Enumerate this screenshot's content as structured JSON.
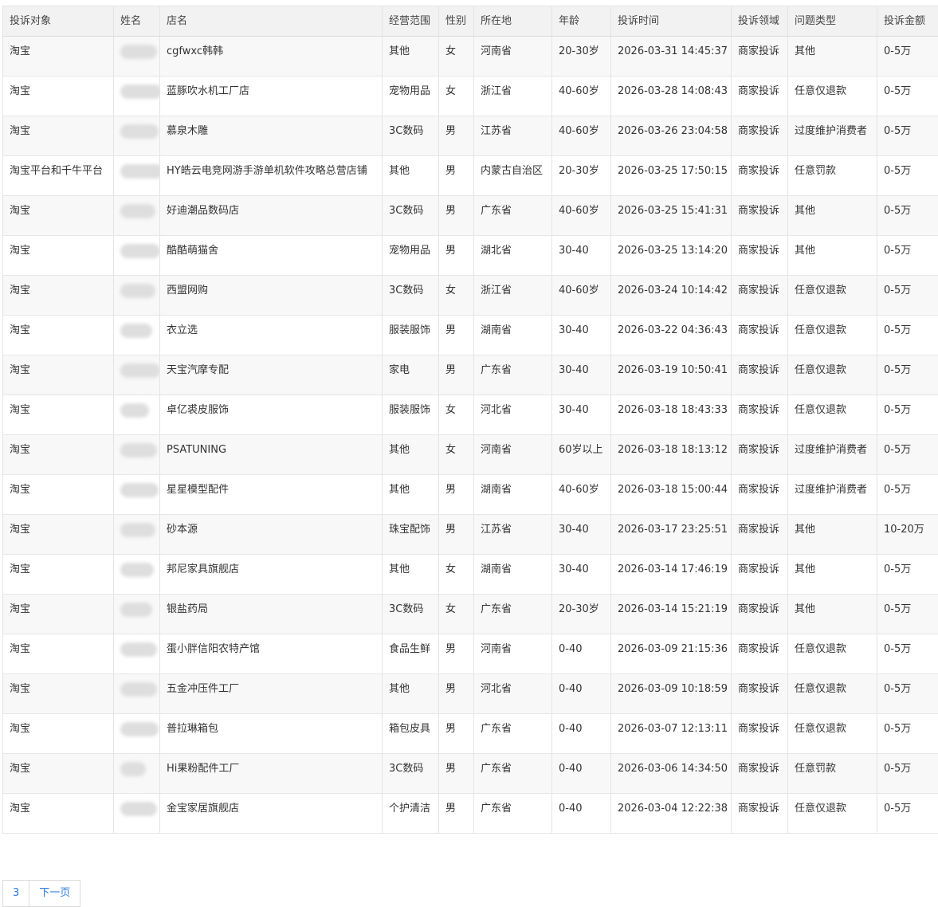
{
  "columns": [
    "投诉对象",
    "姓名",
    "店名",
    "经营范围",
    "性别",
    "所在地",
    "年龄",
    "投诉时间",
    "投诉领域",
    "问题类型",
    "投诉金额"
  ],
  "rows": [
    {
      "target": "淘宝",
      "name": "",
      "shop": "cgfwxc韩韩",
      "scope": "其他",
      "gender": "女",
      "location": "河南省",
      "age": "20-30岁",
      "time": "2026-03-31 14:45:37",
      "field": "商家投诉",
      "issue": "其他",
      "amount": "0-5万"
    },
    {
      "target": "淘宝",
      "name": "",
      "shop": "蓝豚吹水机工厂店",
      "scope": "宠物用品",
      "gender": "女",
      "location": "浙江省",
      "age": "40-60岁",
      "time": "2026-03-28 14:08:43",
      "field": "商家投诉",
      "issue": "任意仅退款",
      "amount": "0-5万"
    },
    {
      "target": "淘宝",
      "name": "",
      "shop": "慕泉木雕",
      "scope": "3C数码",
      "gender": "男",
      "location": "江苏省",
      "age": "40-60岁",
      "time": "2026-03-26 23:04:58",
      "field": "商家投诉",
      "issue": "过度维护消费者",
      "amount": "0-5万"
    },
    {
      "target": "淘宝平台和千牛平台",
      "name": "",
      "shop": "HY皓云电竞网游手游单机软件攻略总营店铺",
      "scope": "其他",
      "gender": "男",
      "location": "内蒙古自治区",
      "age": "20-30岁",
      "time": "2026-03-25 17:50:15",
      "field": "商家投诉",
      "issue": "任意罚款",
      "amount": "0-5万"
    },
    {
      "target": "淘宝",
      "name": "",
      "shop": "好迪潮品数码店",
      "scope": "3C数码",
      "gender": "男",
      "location": "广东省",
      "age": "40-60岁",
      "time": "2026-03-25 15:41:31",
      "field": "商家投诉",
      "issue": "其他",
      "amount": "0-5万"
    },
    {
      "target": "淘宝",
      "name": "",
      "shop": "酷酷萌猫舍",
      "scope": "宠物用品",
      "gender": "男",
      "location": "湖北省",
      "age": "30-40",
      "time": "2026-03-25 13:14:20",
      "field": "商家投诉",
      "issue": "其他",
      "amount": "0-5万"
    },
    {
      "target": "淘宝",
      "name": "",
      "shop": "西盟网购",
      "scope": "3C数码",
      "gender": "女",
      "location": "浙江省",
      "age": "40-60岁",
      "time": "2026-03-24 10:14:42",
      "field": "商家投诉",
      "issue": "任意仅退款",
      "amount": "0-5万"
    },
    {
      "target": "淘宝",
      "name": "",
      "shop": "衣立选",
      "scope": "服装服饰",
      "gender": "男",
      "location": "湖南省",
      "age": "30-40",
      "time": "2026-03-22 04:36:43",
      "field": "商家投诉",
      "issue": "任意仅退款",
      "amount": "0-5万"
    },
    {
      "target": "淘宝",
      "name": "",
      "shop": "天宝汽摩专配",
      "scope": "家电",
      "gender": "男",
      "location": "广东省",
      "age": "30-40",
      "time": "2026-03-19 10:50:41",
      "field": "商家投诉",
      "issue": "任意仅退款",
      "amount": "0-5万"
    },
    {
      "target": "淘宝",
      "name": "",
      "shop": "卓亿裘皮服饰",
      "scope": "服装服饰",
      "gender": "女",
      "location": "河北省",
      "age": "30-40",
      "time": "2026-03-18 18:43:33",
      "field": "商家投诉",
      "issue": "任意仅退款",
      "amount": "0-5万"
    },
    {
      "target": "淘宝",
      "name": "",
      "shop": "PSATUNING",
      "scope": "其他",
      "gender": "女",
      "location": "河南省",
      "age": "60岁以上",
      "time": "2026-03-18 18:13:12",
      "field": "商家投诉",
      "issue": "过度维护消费者",
      "amount": "0-5万"
    },
    {
      "target": "淘宝",
      "name": "",
      "shop": "星星模型配件",
      "scope": "其他",
      "gender": "男",
      "location": "湖南省",
      "age": "40-60岁",
      "time": "2026-03-18 15:00:44",
      "field": "商家投诉",
      "issue": "过度维护消费者",
      "amount": "0-5万"
    },
    {
      "target": "淘宝",
      "name": "",
      "shop": "砂本源",
      "scope": "珠宝配饰",
      "gender": "男",
      "location": "江苏省",
      "age": "30-40",
      "time": "2026-03-17 23:25:51",
      "field": "商家投诉",
      "issue": "其他",
      "amount": "10-20万"
    },
    {
      "target": "淘宝",
      "name": "",
      "shop": "邦尼家具旗舰店",
      "scope": "其他",
      "gender": "女",
      "location": "湖南省",
      "age": "30-40",
      "time": "2026-03-14 17:46:19",
      "field": "商家投诉",
      "issue": "其他",
      "amount": "0-5万"
    },
    {
      "target": "淘宝",
      "name": "",
      "shop": "银盐药局",
      "scope": "3C数码",
      "gender": "女",
      "location": "广东省",
      "age": "20-30岁",
      "time": "2026-03-14 15:21:19",
      "field": "商家投诉",
      "issue": "其他",
      "amount": "0-5万"
    },
    {
      "target": "淘宝",
      "name": "",
      "shop": "蛋小胖信阳农特产馆",
      "scope": "食品生鲜",
      "gender": "男",
      "location": "河南省",
      "age": "0-40",
      "time": "2026-03-09 21:15:36",
      "field": "商家投诉",
      "issue": "任意仅退款",
      "amount": "0-5万"
    },
    {
      "target": "淘宝",
      "name": "",
      "shop": "五金冲压件工厂",
      "scope": "其他",
      "gender": "男",
      "location": "河北省",
      "age": "0-40",
      "time": "2026-03-09 10:18:59",
      "field": "商家投诉",
      "issue": "任意仅退款",
      "amount": "0-5万"
    },
    {
      "target": "淘宝",
      "name": "",
      "shop": "普拉琳箱包",
      "scope": "箱包皮具",
      "gender": "男",
      "location": "广东省",
      "age": "0-40",
      "time": "2026-03-07 12:13:11",
      "field": "商家投诉",
      "issue": "任意仅退款",
      "amount": "0-5万"
    },
    {
      "target": "淘宝",
      "name": "",
      "shop": "Hi果粉配件工厂",
      "scope": "3C数码",
      "gender": "男",
      "location": "广东省",
      "age": "0-40",
      "time": "2026-03-06 14:34:50",
      "field": "商家投诉",
      "issue": "任意罚款",
      "amount": "0-5万"
    },
    {
      "target": "淘宝",
      "name": "",
      "shop": "金宝家居旗舰店",
      "scope": "个护清洁",
      "gender": "男",
      "location": "广东省",
      "age": "0-40",
      "time": "2026-03-04 12:22:38",
      "field": "商家投诉",
      "issue": "任意仅退款",
      "amount": "0-5万"
    }
  ],
  "pagination": {
    "page": "3",
    "next_label": "下一页"
  }
}
